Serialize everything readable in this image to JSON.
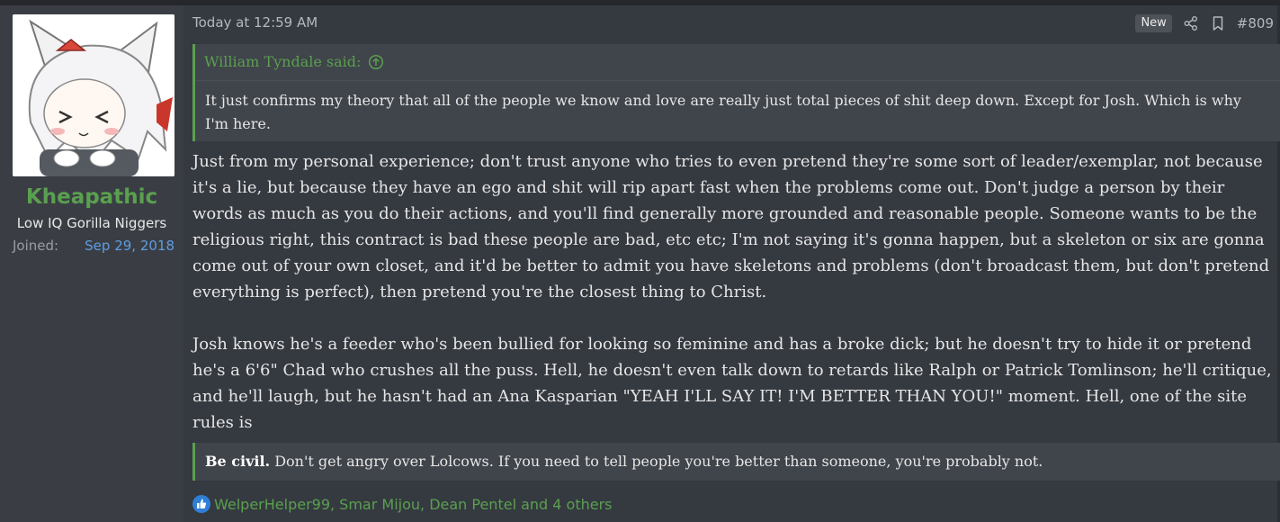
{
  "user": {
    "name": "Kheapathic",
    "title": "Low IQ Gorilla Niggers",
    "joined_label": "Joined:",
    "joined_date": "Sep 29, 2018"
  },
  "post": {
    "date": "Today at 12:59 AM",
    "badge": "New",
    "number": "#809",
    "quote": {
      "author": "William Tyndale said:",
      "text": "It just confirms my theory that all of the people we know and love are really just total pieces of shit deep down. Except for Josh. Which is why I'm here."
    },
    "paragraphs": [
      "Just from my personal experience; don't trust anyone who tries to even pretend they're some sort of leader/exemplar, not because it's a lie, but because they have an ego and shit will rip apart fast when the problems come out. Don't judge a person by their words as much as you do their actions, and you'll find generally more grounded and reasonable people. Someone wants to be the religious right, this contract is bad these people are bad, etc etc; I'm not saying it's gonna happen, but a skeleton or six are gonna come out of your own closet, and it'd be better to admit you have skeletons and problems (don't broadcast them, but don't pretend everything is perfect), then pretend you're the closest thing to Christ.",
      "Josh knows he's a feeder who's been bullied for looking so feminine and has a broke dick; but he doesn't try to hide it or pretend he's a 6'6\" Chad who crushes all the puss. Hell, he doesn't even talk down to retards like Ralph or Patrick Tomlinson; he'll critique, and he'll laugh, but he hasn't had an Ana Kasparian \"YEAH I'LL SAY IT! I'M BETTER THAN YOU!\" moment. Hell, one of the site rules is"
    ],
    "rule_quote": {
      "bold": "Be civil.",
      "text": " Don't get angry over Lolcows. If you need to tell people you're better than someone, you're probably not."
    },
    "reactions": "WelperHelper99, Smar Mijou, Dean Pentel and 4 others"
  },
  "colors": {
    "accent_green": "#5aa04f",
    "link_blue": "#5f9cdf",
    "like_blue": "#2f7fd6"
  },
  "icons": [
    "share-icon",
    "bookmark-icon",
    "arrow-up-circle-icon",
    "like-icon"
  ]
}
